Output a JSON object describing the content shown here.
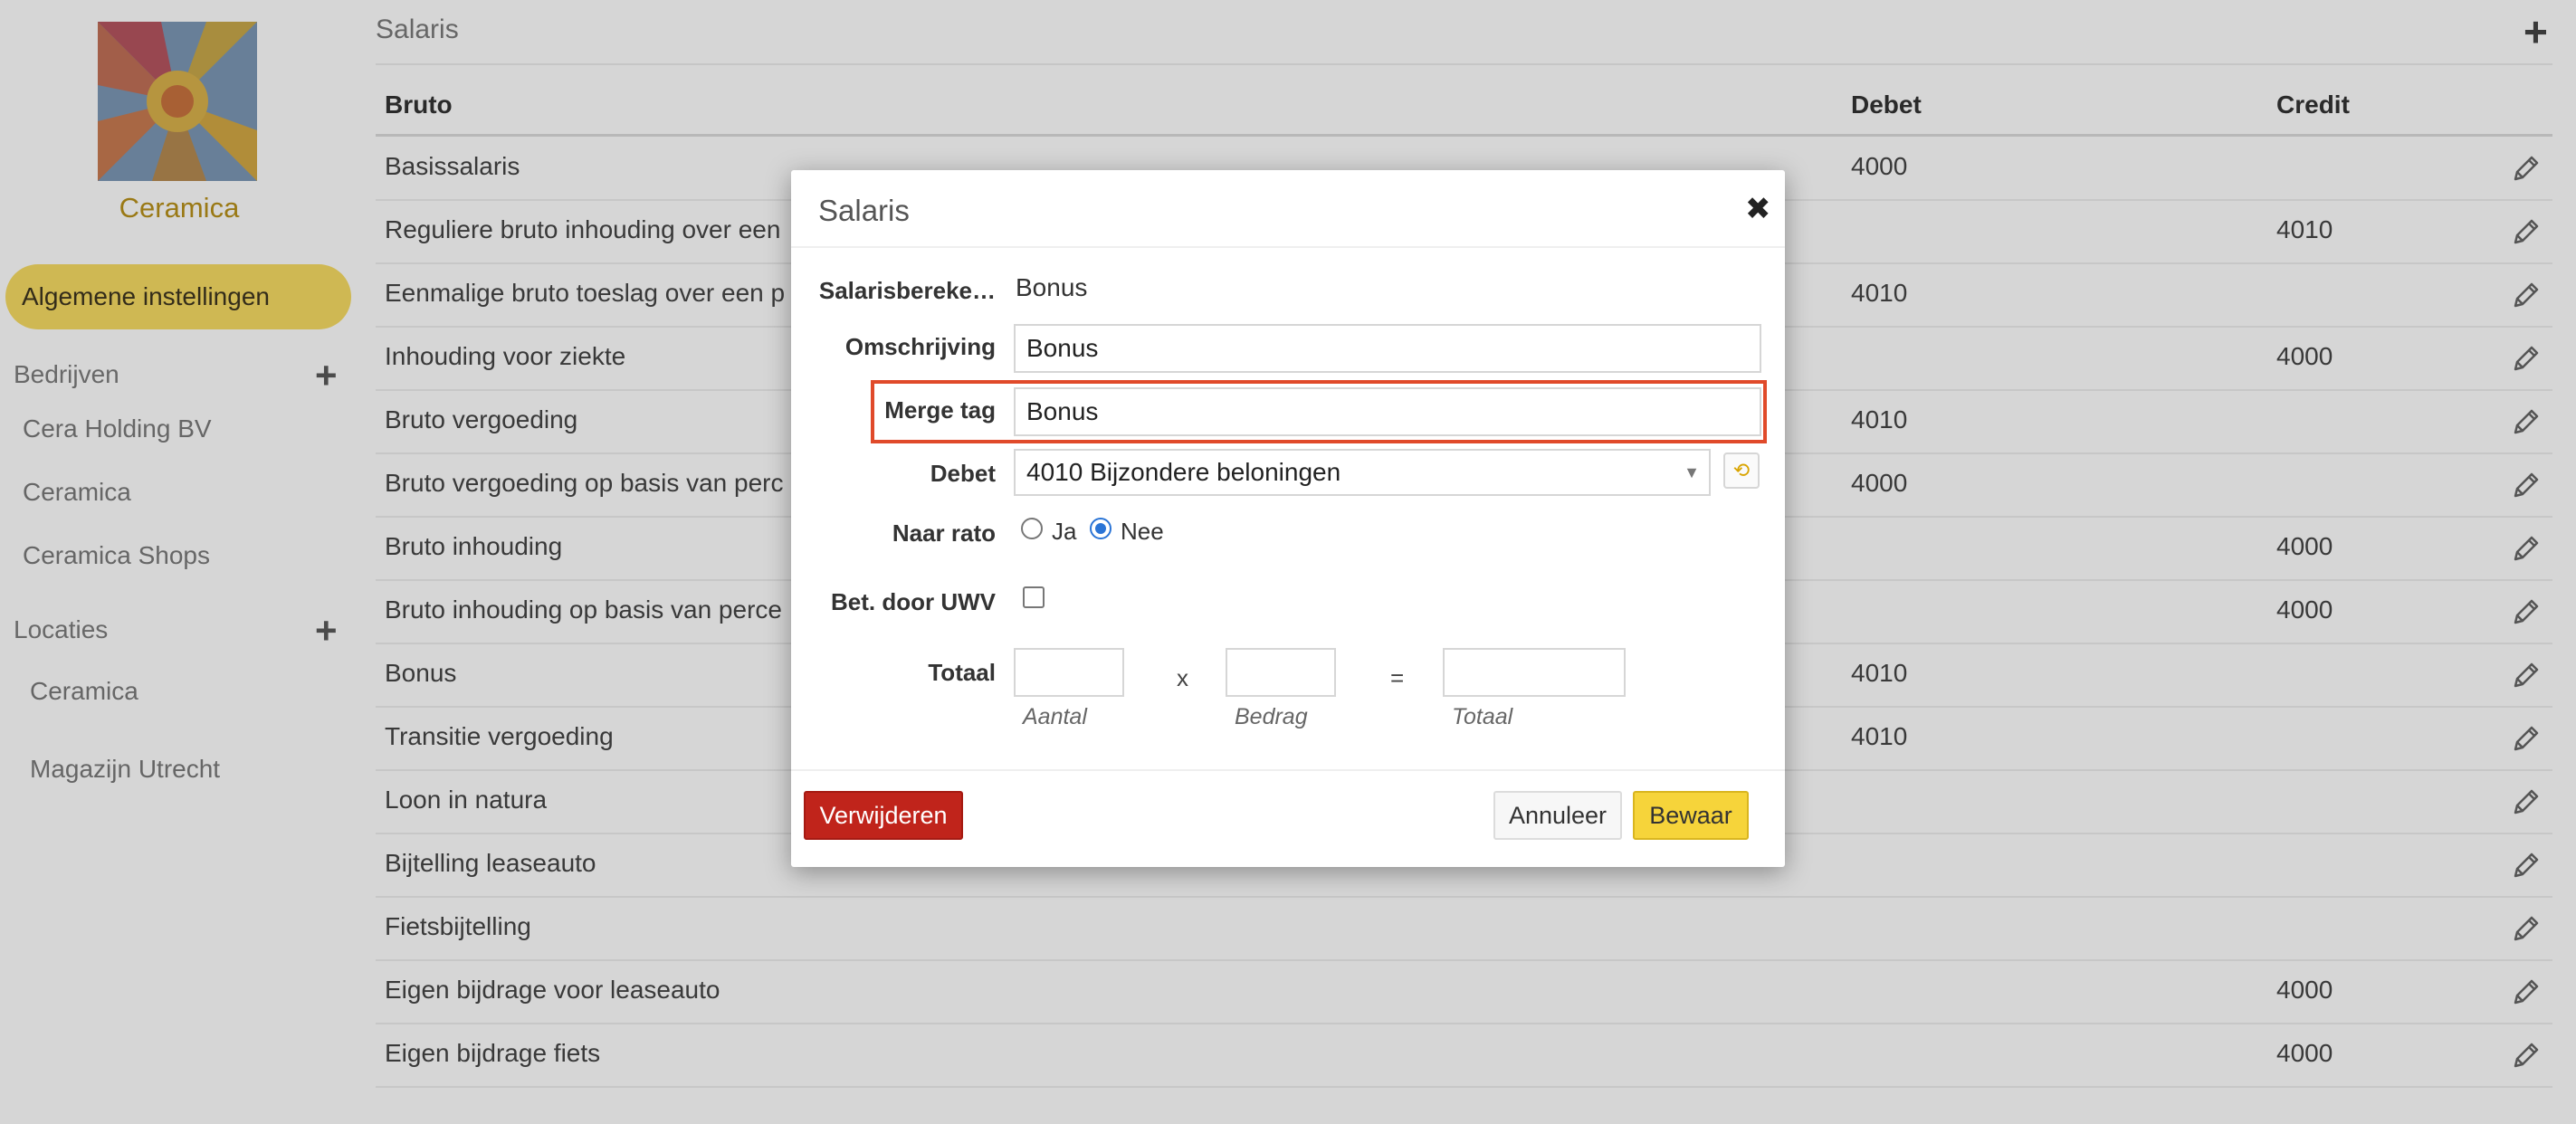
{
  "sidebar": {
    "company_name": "Ceramica",
    "active_item": "Algemene instellingen",
    "companies_title": "Bedrijven",
    "companies": [
      "Cera Holding BV",
      "Ceramica",
      "Ceramica Shops"
    ],
    "locations_title": "Locaties",
    "locations": [
      "Ceramica",
      "Magazijn Utrecht"
    ],
    "add_symbol": "+"
  },
  "panel": {
    "title": "Salaris",
    "add_symbol": "+",
    "columns": {
      "name": "Bruto",
      "debit": "Debet",
      "credit": "Credit"
    },
    "rows": [
      {
        "name": "Basissalaris",
        "debit": "4000",
        "credit": ""
      },
      {
        "name": "Reguliere bruto inhouding over een",
        "debit": "",
        "credit": "4010"
      },
      {
        "name": "Eenmalige bruto toeslag over een p",
        "debit": "4010",
        "credit": ""
      },
      {
        "name": "Inhouding voor ziekte",
        "debit": "",
        "credit": "4000"
      },
      {
        "name": "Bruto vergoeding",
        "debit": "4010",
        "credit": ""
      },
      {
        "name": "Bruto vergoeding op basis van perc",
        "debit": "4000",
        "credit": ""
      },
      {
        "name": "Bruto inhouding",
        "debit": "",
        "credit": "4000"
      },
      {
        "name": "Bruto inhouding op basis van perce",
        "debit": "",
        "credit": "4000"
      },
      {
        "name": "Bonus",
        "debit": "4010",
        "credit": ""
      },
      {
        "name": "Transitie vergoeding",
        "debit": "4010",
        "credit": ""
      },
      {
        "name": "Loon in natura",
        "debit": "",
        "credit": ""
      },
      {
        "name": "Bijtelling leaseauto",
        "debit": "",
        "credit": ""
      },
      {
        "name": "Fietsbijtelling",
        "debit": "",
        "credit": ""
      },
      {
        "name": "Eigen bijdrage voor leaseauto",
        "debit": "",
        "credit": "4000"
      },
      {
        "name": "Eigen bijdrage fiets",
        "debit": "",
        "credit": "4000"
      }
    ]
  },
  "modal": {
    "title": "Salaris",
    "close_symbol": "✖",
    "calc_label": "Salarisbereke…",
    "calc_value": "Bonus",
    "description_label": "Omschrijving",
    "description_value": "Bonus",
    "merge_tag_label": "Merge tag",
    "merge_tag_value": "Bonus",
    "debit_label": "Debet",
    "debit_value": "4010 Bijzondere beloningen",
    "pro_rata_label": "Naar rato",
    "pro_rata_yes": "Ja",
    "pro_rata_no": "Nee",
    "pro_rata_selected": "Nee",
    "paid_by_uwv_label": "Bet. door UWV",
    "paid_by_uwv_checked": false,
    "total_label": "Totaal",
    "times_symbol": "x",
    "equals_symbol": "=",
    "quantity_hint": "Aantal",
    "amount_hint": "Bedrag",
    "total_hint": "Totaal",
    "delete_button": "Verwijderen",
    "cancel_button": "Annuleer",
    "save_button": "Bewaar"
  },
  "colors": {
    "accent_yellow": "#f7dc63",
    "brand_gold": "#b8911a",
    "delete_red": "#c0241b",
    "highlight_red": "#e04a2a",
    "save_yellow": "#f6d43a"
  }
}
